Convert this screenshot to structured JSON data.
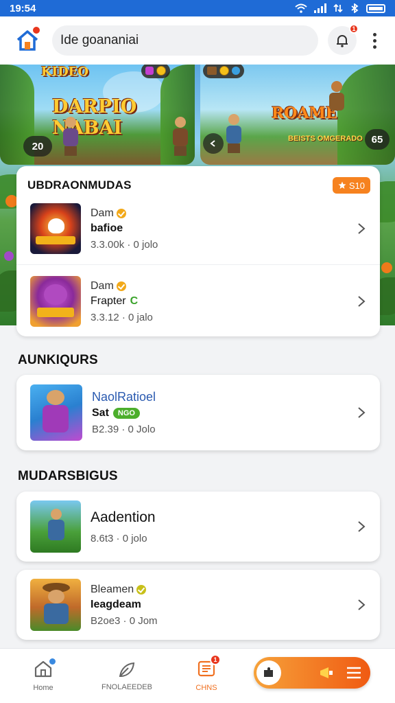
{
  "status_bar": {
    "time": "19:54"
  },
  "app_bar": {
    "search_text": "Ide goananiai",
    "notification_count": "1"
  },
  "hero": {
    "banner_left": {
      "logo_text": "KIDEO",
      "title": "DARPIO NABAI",
      "counter": "20"
    },
    "banner_right": {
      "title": "ROAME",
      "caption": "BEISTS OMGERADO",
      "score": "65"
    }
  },
  "sections": [
    {
      "title": "UBDRAONMUDAS",
      "badge": "S10",
      "items": [
        {
          "line1": "Dam",
          "line2": "bafioe",
          "line3": "3.3.00k · 0 jolo"
        },
        {
          "line1": "Dam",
          "line2": "Frapter",
          "line3": "3.3.12 · 0 jalo",
          "extra": "C"
        }
      ]
    },
    {
      "title": "AUNKIQURS",
      "items": [
        {
          "line1": "NaolRatioel",
          "line2": "Sat",
          "pill": "NGO",
          "line3": "B2.39 · 0 Jolo"
        }
      ]
    },
    {
      "title": "MUDARSBIGUS",
      "items": [
        {
          "line1": "Aadention",
          "line3": "8.6t3 · 0 jolo"
        },
        {
          "line1": "Bleamen",
          "line2": "Ieagdeam",
          "line3": "B2oe3 · 0 Jom"
        }
      ]
    }
  ],
  "bottom_nav": {
    "items": [
      {
        "label": "Home"
      },
      {
        "label": "FNOLAEEDEB"
      },
      {
        "label": "CHNS"
      }
    ],
    "chns_badge": "1"
  },
  "colors": {
    "accent": "#f6821f",
    "primary": "#1f6bd6",
    "badge": "#e8361d"
  }
}
